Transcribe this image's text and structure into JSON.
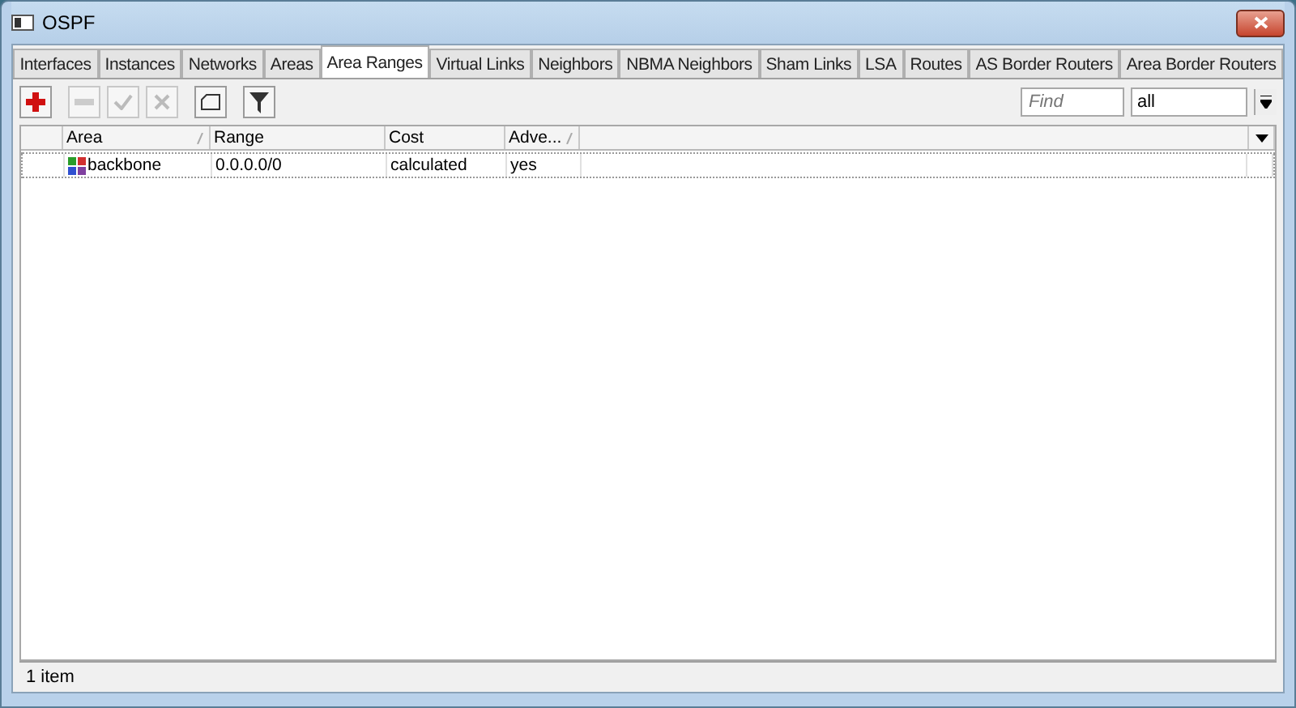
{
  "window": {
    "title": "OSPF"
  },
  "tabs": [
    {
      "label": "Interfaces",
      "selected": false
    },
    {
      "label": "Instances",
      "selected": false
    },
    {
      "label": "Networks",
      "selected": false
    },
    {
      "label": "Areas",
      "selected": false
    },
    {
      "label": "Area Ranges",
      "selected": true
    },
    {
      "label": "Virtual Links",
      "selected": false
    },
    {
      "label": "Neighbors",
      "selected": false
    },
    {
      "label": "NBMA Neighbors",
      "selected": false
    },
    {
      "label": "Sham Links",
      "selected": false
    },
    {
      "label": "LSA",
      "selected": false
    },
    {
      "label": "Routes",
      "selected": false
    },
    {
      "label": "AS Border Routers",
      "selected": false
    },
    {
      "label": "Area Border Routers",
      "selected": false
    }
  ],
  "toolbar": {
    "buttons": [
      {
        "kind": "add",
        "disabled": false
      },
      {
        "kind": "remove",
        "disabled": true
      },
      {
        "kind": "enable",
        "disabled": true
      },
      {
        "kind": "disable",
        "disabled": true
      },
      {
        "kind": "comment",
        "disabled": false
      },
      {
        "kind": "filter",
        "disabled": false
      }
    ],
    "find": {
      "placeholder": "Find"
    },
    "filter_select": {
      "value": "all"
    }
  },
  "table": {
    "columns": [
      {
        "label": "Area",
        "sorted": true
      },
      {
        "label": "Range",
        "sorted": false
      },
      {
        "label": "Cost",
        "sorted": false
      },
      {
        "label": "Adve...",
        "sorted": true
      }
    ],
    "rows": [
      {
        "cells": [
          "backbone",
          "0.0.0.0/0",
          "calculated",
          "yes"
        ]
      }
    ]
  },
  "status_bar": {
    "text": "1 item"
  }
}
